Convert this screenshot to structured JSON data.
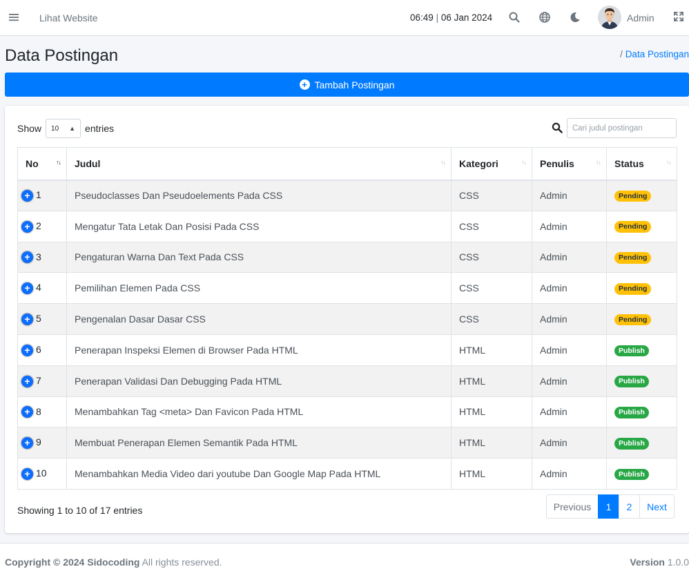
{
  "topbar": {
    "view_site": "Lihat Website",
    "time": "06:49",
    "date": "06 Jan 2024",
    "user": "Admin"
  },
  "page": {
    "title": "Data Postingan",
    "breadcrumb_sep": "/",
    "breadcrumb": "Data Postingan"
  },
  "add_button": "Tambah Postingan",
  "table_controls": {
    "show_label": "Show",
    "entries_value": "10",
    "entries_label": "entries",
    "search_placeholder": "Cari judul postingan"
  },
  "columns": [
    "No",
    "Judul",
    "Kategori",
    "Penulis",
    "Status"
  ],
  "rows": [
    {
      "no": "1",
      "judul": "Pseudoclasses Dan Pseudoelements Pada CSS",
      "kategori": "CSS",
      "penulis": "Admin",
      "status": "Pending"
    },
    {
      "no": "2",
      "judul": "Mengatur Tata Letak Dan Posisi Pada CSS",
      "kategori": "CSS",
      "penulis": "Admin",
      "status": "Pending"
    },
    {
      "no": "3",
      "judul": "Pengaturan Warna Dan Text Pada CSS",
      "kategori": "CSS",
      "penulis": "Admin",
      "status": "Pending"
    },
    {
      "no": "4",
      "judul": "Pemilihan Elemen Pada CSS",
      "kategori": "CSS",
      "penulis": "Admin",
      "status": "Pending"
    },
    {
      "no": "5",
      "judul": "Pengenalan Dasar Dasar CSS",
      "kategori": "CSS",
      "penulis": "Admin",
      "status": "Pending"
    },
    {
      "no": "6",
      "judul": "Penerapan Inspeksi Elemen di Browser Pada HTML",
      "kategori": "HTML",
      "penulis": "Admin",
      "status": "Publish"
    },
    {
      "no": "7",
      "judul": "Penerapan Validasi Dan Debugging Pada HTML",
      "kategori": "HTML",
      "penulis": "Admin",
      "status": "Publish"
    },
    {
      "no": "8",
      "judul": "Menambahkan Tag <meta> Dan Favicon Pada HTML",
      "kategori": "HTML",
      "penulis": "Admin",
      "status": "Publish"
    },
    {
      "no": "9",
      "judul": "Membuat Penerapan Elemen Semantik Pada HTML",
      "kategori": "HTML",
      "penulis": "Admin",
      "status": "Publish"
    },
    {
      "no": "10",
      "judul": "Menambahkan Media Video dari youtube Dan Google Map Pada HTML",
      "kategori": "HTML",
      "penulis": "Admin",
      "status": "Publish"
    }
  ],
  "pagination": {
    "info": "Showing 1 to 10 of 17 entries",
    "previous": "Previous",
    "pages": [
      "1",
      "2"
    ],
    "next": "Next"
  },
  "footer": {
    "copyright": "Copyright © 2024 Sidocoding",
    "rights": " All rights reserved.",
    "version_label": "Version",
    "version": " 1.0.0"
  },
  "colors": {
    "primary": "#007bff",
    "pending": "#ffc107",
    "publish": "#28a745"
  }
}
